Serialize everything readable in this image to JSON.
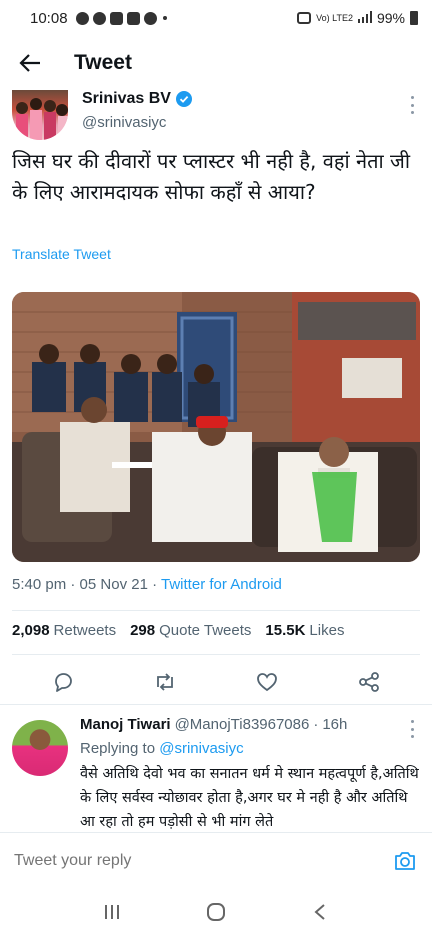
{
  "status_bar": {
    "time": "10:08",
    "network": "Vo) LTE2",
    "battery": "99%"
  },
  "header": {
    "title": "Tweet"
  },
  "tweet": {
    "author_name": "Srinivas BV",
    "author_handle": "@srinivasiyc",
    "text": "जिस घर की दीवारों पर प्लास्टर भी नही है, वहां नेता जी के लिए आरामदायक सोफा कहाँ से आया?",
    "translate_label": "Translate Tweet",
    "time": "5:40 pm",
    "date": "05 Nov 21",
    "source": "Twitter for Android",
    "retweets_count": "2,098",
    "retweets_label": "Retweets",
    "quote_count": "298",
    "quote_label": "Quote Tweets",
    "likes_count": "15.5K",
    "likes_label": "Likes"
  },
  "reply": {
    "name": "Manoj Tiwari",
    "handle": "@ManojTi83967086",
    "age": "16h",
    "replying_label": "Replying to",
    "replying_to": "@srinivasiyc",
    "text": "वैसे अतिथि देवो भव का सनातन धर्म मे स्थान महत्वपूर्ण है,अतिथि के लिए सर्वस्व न्योछावर होता है,अगर घर मे नही है और अतिथि आ रहा तो हम पड़ोसी से भी मांग लेते"
  },
  "composer": {
    "placeholder": "Tweet your reply"
  },
  "colors": {
    "accent": "#1d9bf0",
    "text_primary": "#0f1419",
    "text_secondary": "#536471"
  },
  "icons": [
    "back-arrow-icon",
    "verified-badge-icon",
    "more-vertical-icon",
    "reply-icon",
    "retweet-icon",
    "like-icon",
    "share-icon",
    "camera-icon",
    "recents-icon",
    "home-icon",
    "back-icon"
  ]
}
